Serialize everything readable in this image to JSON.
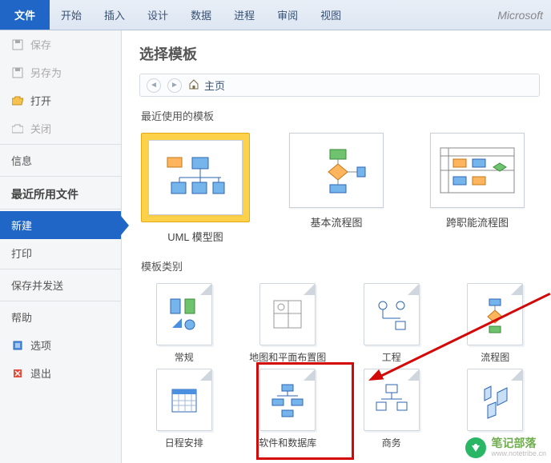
{
  "ribbon": {
    "tabs": [
      "文件",
      "开始",
      "插入",
      "设计",
      "数据",
      "进程",
      "审阅",
      "视图"
    ],
    "active_index": 0,
    "app_title": "Microsoft"
  },
  "sidebar": {
    "save": "保存",
    "save_as": "另存为",
    "open": "打开",
    "close": "关闭",
    "info": "信息",
    "recent_header": "最近所用文件",
    "new": "新建",
    "print": "打印",
    "save_send": "保存并发送",
    "help": "帮助",
    "options": "选项",
    "exit": "退出"
  },
  "main": {
    "title": "选择模板",
    "home": "主页",
    "recent_label": "最近使用的模板",
    "recent_templates": [
      {
        "label": "UML 模型图"
      },
      {
        "label": "基本流程图"
      },
      {
        "label": "跨职能流程图"
      }
    ],
    "categories_label": "模板类别",
    "categories": [
      {
        "label": "常规"
      },
      {
        "label": "地图和平面布置图"
      },
      {
        "label": "工程"
      },
      {
        "label": "流程图"
      },
      {
        "label": "日程安排"
      },
      {
        "label": "软件和数据库"
      },
      {
        "label": "商务"
      }
    ]
  },
  "watermark": {
    "line1": "笔记部落",
    "line2": "www.notetribe.cn"
  }
}
